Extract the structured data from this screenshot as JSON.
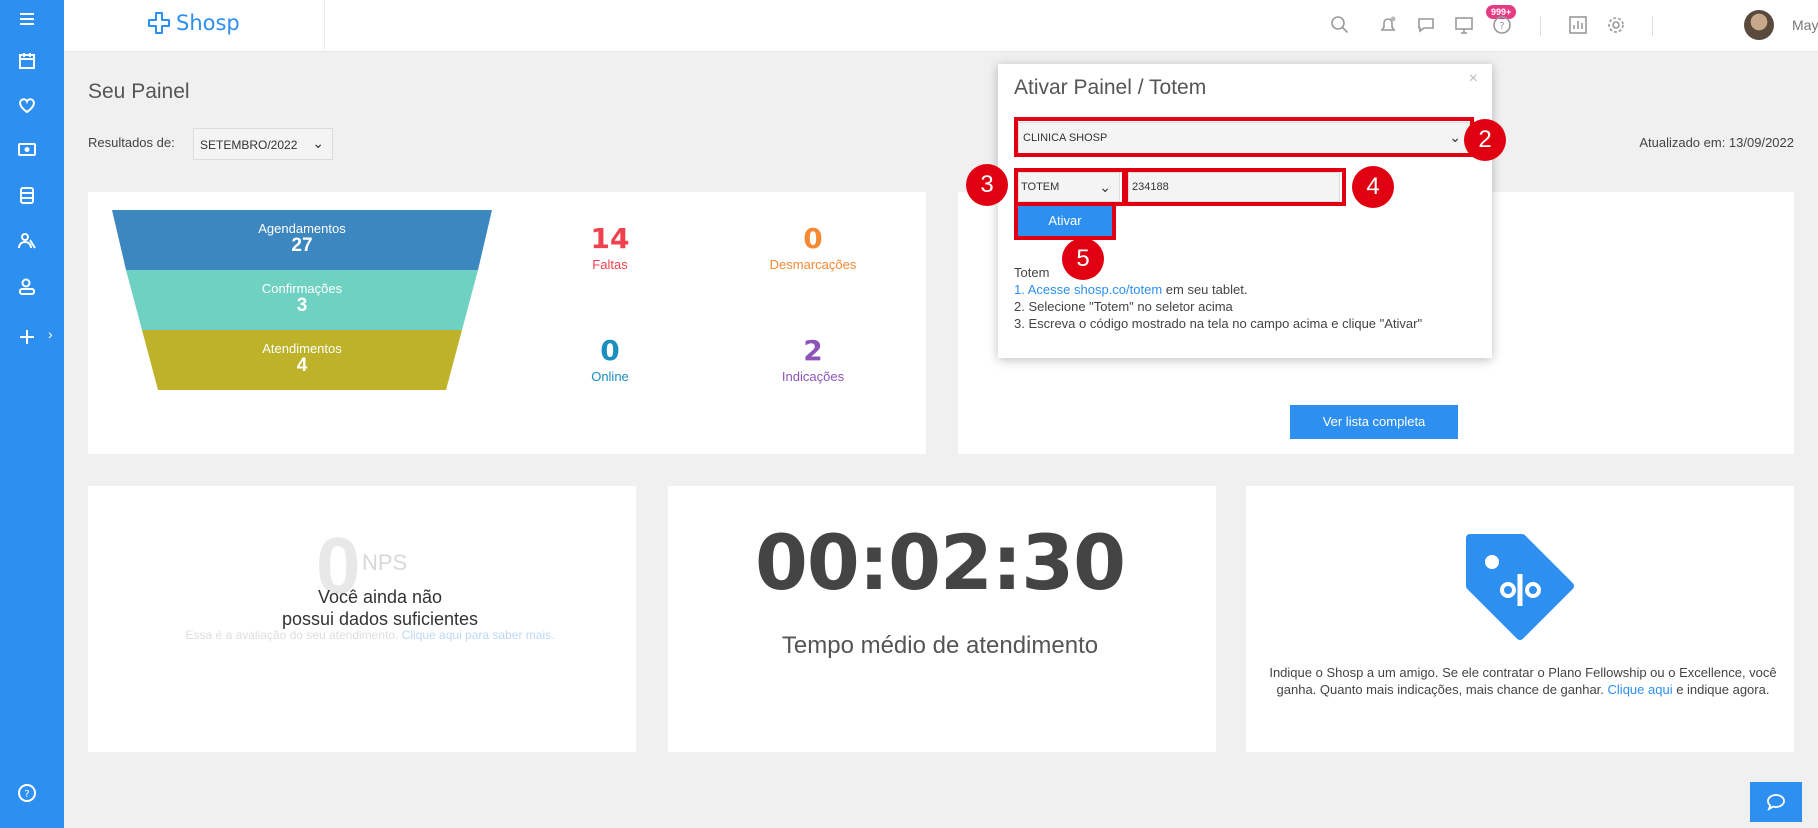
{
  "header": {
    "logo_text": "Shosp",
    "notification_badge": "999+",
    "user_name": "Maycon"
  },
  "page": {
    "title": "Seu Painel",
    "results_label": "Resultados de:",
    "month_value": "SETEMBRO/2022",
    "updated_text": "Atualizado em: 13/09/2022"
  },
  "funnel": {
    "stages": [
      {
        "label": "Agendamentos",
        "value": "27"
      },
      {
        "label": "Confirmações",
        "value": "3"
      },
      {
        "label": "Atendimentos",
        "value": "4"
      }
    ]
  },
  "stats": {
    "faltas": {
      "value": "14",
      "label": "Faltas",
      "color": "#f0424e"
    },
    "desmarcacoes": {
      "value": "0",
      "label": "Desmarcações",
      "color": "#f58a35"
    },
    "online": {
      "value": "0",
      "label": "Online",
      "color": "#1b8fbe"
    },
    "indicacoes": {
      "value": "2",
      "label": "Indicações",
      "color": "#8d55b8"
    }
  },
  "list_button": "Ver lista completa",
  "nps": {
    "score": "0",
    "label": "NPS",
    "message_line1": "Você ainda não",
    "message_line2": "possui dados suficientes",
    "hint": "Essa é a avaliação do seu atendimento.",
    "hint_link": "Clique aqui para saber mais."
  },
  "timer": {
    "value": "00:02:30",
    "label": "Tempo médio de atendimento"
  },
  "referral": {
    "text": "Indique o Shosp a um amigo. Se ele contratar o Plano Fellowship ou o Excellence, você ganha. Quanto mais indicações, mais chance de ganhar.",
    "link": "Clique aqui",
    "tail": "e indique agora."
  },
  "modal": {
    "title": "Ativar Painel / Totem",
    "close": "×",
    "clinic_value": "CLINICA SHOSP",
    "mode_value": "TOTEM",
    "code_value": "234188",
    "activate_label": "Ativar",
    "instr_title": "Totem",
    "instr_1_pre": "1. Acesse",
    "instr_1_link": "shosp.co/totem",
    "instr_1_post": "em seu tablet.",
    "instr_2": "2. Selecione \"Totem\" no seletor acima",
    "instr_3": "3. Escreva o código mostrado na tela no campo acima e clique \"Ativar\""
  },
  "markers": [
    "2",
    "3",
    "4",
    "5"
  ],
  "colors": {
    "accent": "#2d8ff0",
    "highlight": "#e00012",
    "funnel_1": "#3d87c0",
    "funnel_2": "#6fd1c2",
    "funnel_3": "#bdb22a"
  },
  "icons": [
    "menu-icon",
    "calendar-icon",
    "heart-icon",
    "money-icon",
    "database-icon",
    "users-icon",
    "doctor-icon",
    "plus-icon",
    "help-icon",
    "search-icon",
    "bell-icon",
    "chat-icon",
    "monitor-icon",
    "question-icon",
    "report-icon",
    "settings-icon",
    "tag-icon"
  ]
}
